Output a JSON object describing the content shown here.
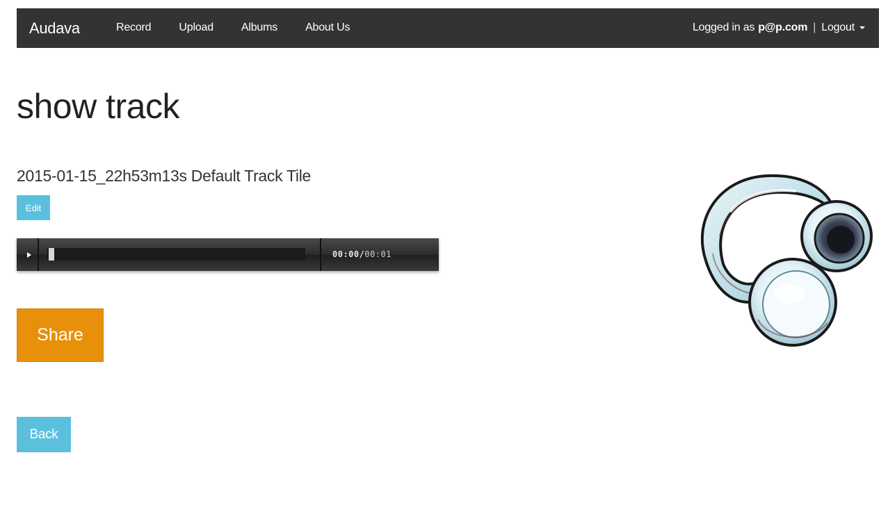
{
  "navbar": {
    "brand": "Audava",
    "links": [
      "Record",
      "Upload",
      "Albums",
      "About Us"
    ],
    "logged_in_prefix": "Logged in as",
    "user": "p@p.com",
    "separator": "|",
    "logout_label": "Logout"
  },
  "page": {
    "title": "show track",
    "track_name": "2015-01-15_22h53m13s Default Track Tile"
  },
  "buttons": {
    "edit": "Edit",
    "share": "Share",
    "back": "Back"
  },
  "player": {
    "current_time": "00:00",
    "time_separator": "/",
    "duration": "00:01",
    "progress": 0.0
  },
  "icons": {
    "play": "play-icon",
    "caret": "caret-down-icon",
    "artwork": "headphones-illustration"
  },
  "colors": {
    "navbar_bg": "#333333",
    "info_button": "#5bc0de",
    "share_button": "#e8900a"
  }
}
